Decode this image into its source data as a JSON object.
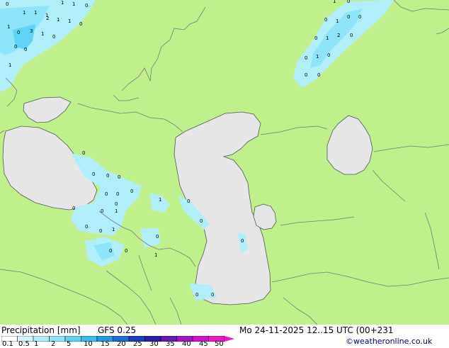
{
  "title": "Precipitation [mm]",
  "model": "GFS 0.25",
  "valid_time": "Mo 24-11-2025 12..15 UTC (00+231",
  "credit": "©weatheronline.co.uk",
  "legend": {
    "ticks": [
      "0.1",
      "0.5",
      "1",
      "2",
      "5",
      "10",
      "15",
      "20",
      "25",
      "30",
      "35",
      "40",
      "45",
      "50"
    ],
    "colors": [
      "#ffffff",
      "#d8f6ff",
      "#b0eefc",
      "#8ee4fa",
      "#60d4f6",
      "#38bdf2",
      "#1e9ae6",
      "#1a6fd6",
      "#1c3fc0",
      "#2a20a8",
      "#6a16b6",
      "#a414c4",
      "#d012d0",
      "#e818c8"
    ]
  },
  "map_colors": {
    "land": "#c0f08c",
    "sea": "#e6e6e6",
    "border": "#7a7a7a",
    "coast": "#555555"
  },
  "precip_labels": [
    "0",
    "1",
    "1",
    "1",
    "1",
    "1",
    "0",
    "2",
    "1",
    "1",
    "0",
    "1",
    "0",
    "3",
    "1",
    "0",
    "0",
    "0",
    "1",
    "1",
    "0",
    "0",
    "1",
    "0",
    "0",
    "2",
    "1",
    "0",
    "0",
    "1",
    "0",
    "0",
    "0",
    "0",
    "0",
    "0",
    "0",
    "0",
    "0",
    "0",
    "0",
    "1",
    "0",
    "0",
    "1",
    "0",
    "0",
    "0",
    "1",
    "0",
    "0",
    "0",
    "0",
    "1",
    "0",
    "0",
    "0",
    "0"
  ]
}
